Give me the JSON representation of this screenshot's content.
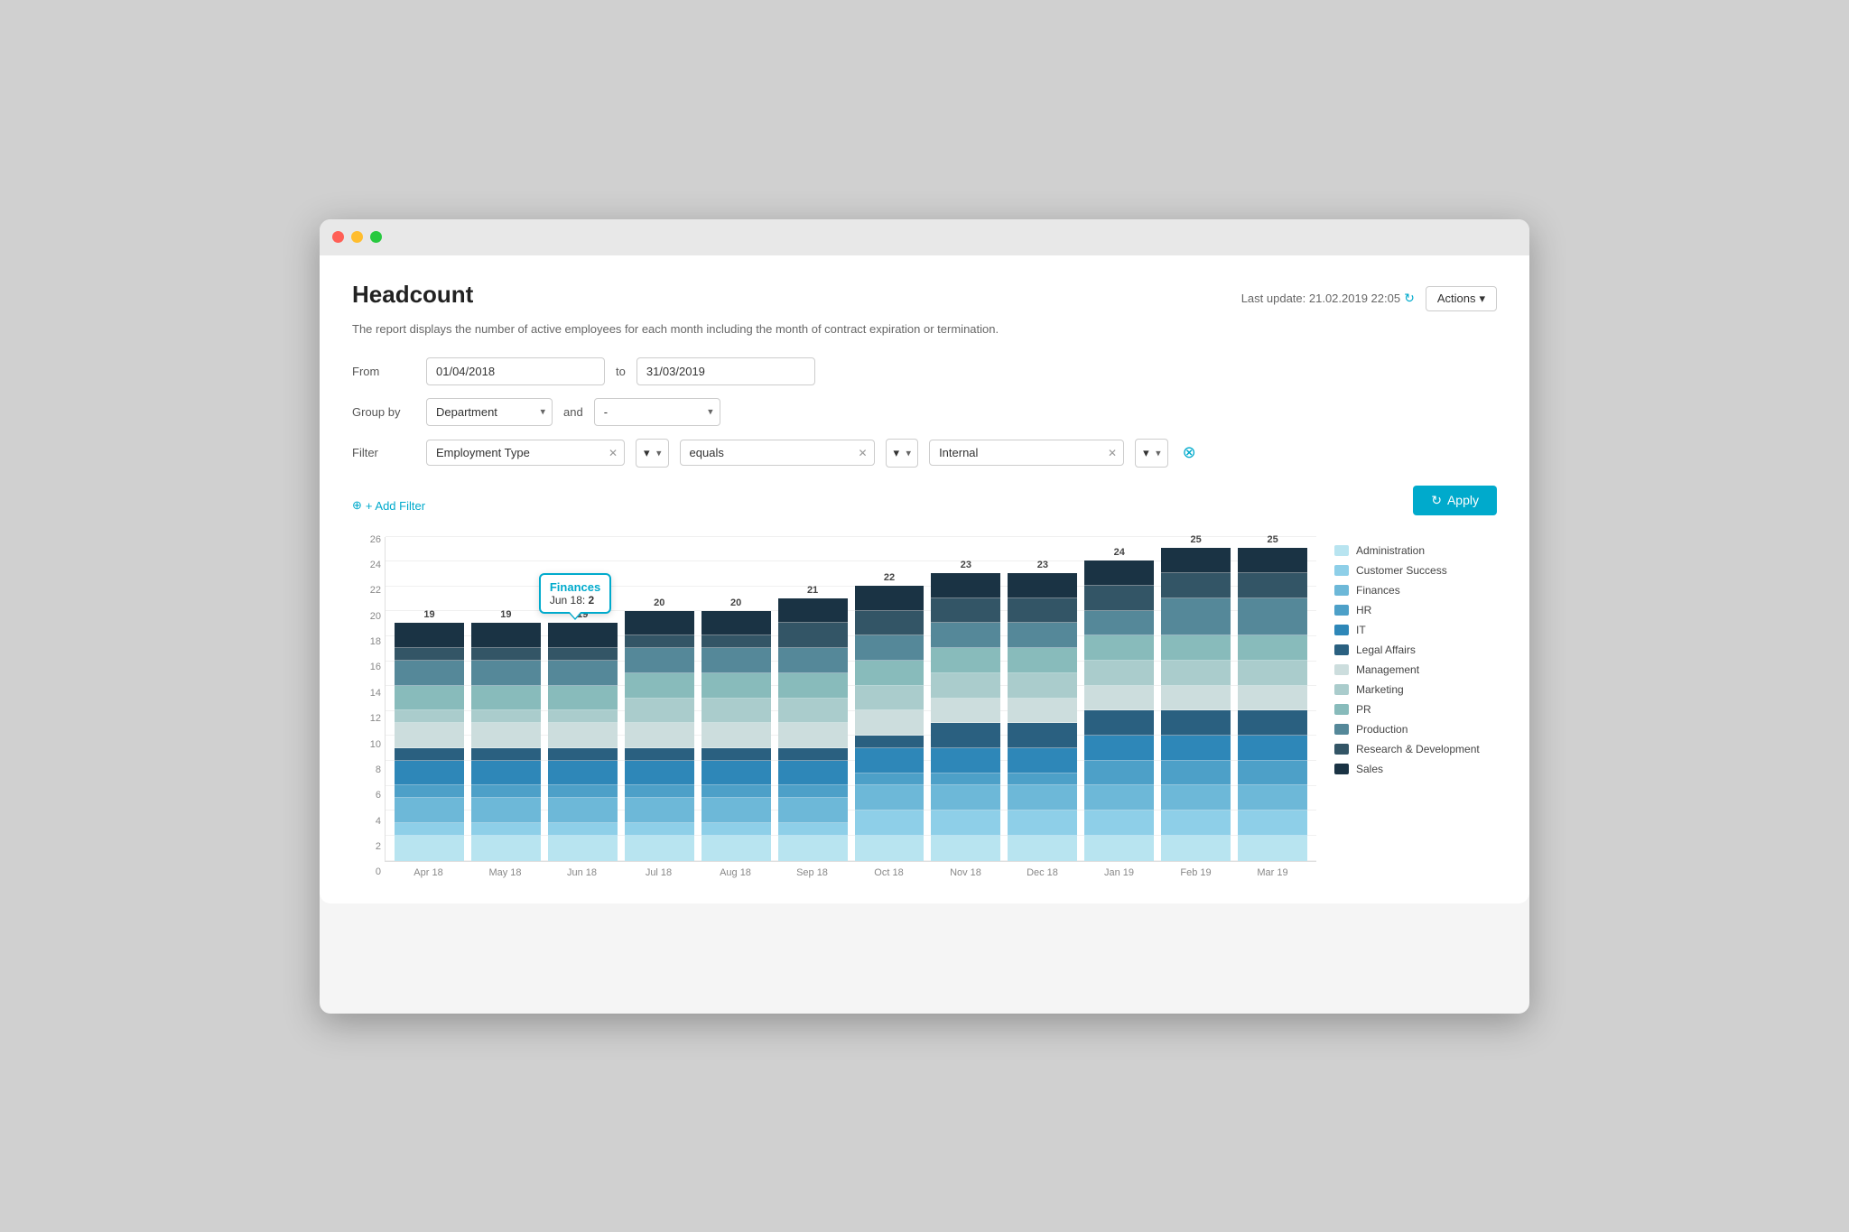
{
  "window": {
    "title": "Headcount"
  },
  "header": {
    "title": "Headcount",
    "last_update_label": "Last update: 21.02.2019 22:05",
    "actions_label": "Actions",
    "description": "The report displays the number of active employees for each month including the month of contract expiration or termination."
  },
  "form": {
    "from_label": "From",
    "from_value": "01/04/2018",
    "to_label": "to",
    "to_value": "31/03/2019",
    "group_by_label": "Group by",
    "group_by_value": "Department",
    "and_label": "and",
    "and_value": "-",
    "filter_label": "Filter",
    "filter_type": "Employment Type",
    "filter_equals": "equals",
    "filter_value": "Internal",
    "add_filter_label": "+ Add Filter",
    "apply_label": "Apply"
  },
  "chart": {
    "y_labels": [
      "0",
      "2",
      "4",
      "6",
      "8",
      "10",
      "12",
      "14",
      "16",
      "18",
      "20",
      "22",
      "24",
      "26"
    ],
    "x_labels": [
      "Apr 18",
      "May 18",
      "Jun 18",
      "Jul 18",
      "Aug 18",
      "Sep 18",
      "Oct 18",
      "Nov 18",
      "Dec 18",
      "Jan 19",
      "Feb 19",
      "Mar 19"
    ],
    "bar_totals": [
      "19",
      "19",
      "19",
      "20",
      "20",
      "21",
      "22",
      "23",
      "23",
      "24",
      "25",
      "25"
    ],
    "tooltip": {
      "title": "Finances",
      "line": "Jun 18: 2"
    },
    "segments": {
      "administration": {
        "color": "#b8e4f0",
        "label": "Administration"
      },
      "customer_success": {
        "color": "#8ecfe8",
        "label": "Customer Success"
      },
      "finances": {
        "color": "#6db8d8",
        "label": "Finances"
      },
      "hr": {
        "color": "#4da0c8",
        "label": "HR"
      },
      "it": {
        "color": "#2e87b8",
        "label": "IT"
      },
      "legal": {
        "color": "#2a6080",
        "label": "Legal Affairs"
      },
      "management": {
        "color": "#ccdddd",
        "label": "Management"
      },
      "marketing": {
        "color": "#aacccc",
        "label": "Marketing"
      },
      "pr": {
        "color": "#88bbbb",
        "label": "PR"
      },
      "production": {
        "color": "#558899",
        "label": "Production"
      },
      "rd": {
        "color": "#335566",
        "label": "Research & Development"
      },
      "sales": {
        "color": "#1a3344",
        "label": "Sales"
      }
    },
    "bars": [
      {
        "total": 19,
        "segments": [
          2,
          1,
          2,
          1,
          2,
          1,
          2,
          1,
          2,
          2,
          1,
          2
        ]
      },
      {
        "total": 19,
        "segments": [
          2,
          1,
          2,
          1,
          2,
          1,
          2,
          1,
          2,
          2,
          1,
          2
        ]
      },
      {
        "total": 19,
        "segments": [
          2,
          1,
          2,
          1,
          2,
          1,
          2,
          1,
          2,
          2,
          1,
          2
        ]
      },
      {
        "total": 20,
        "segments": [
          2,
          1,
          2,
          1,
          2,
          1,
          2,
          2,
          2,
          2,
          1,
          2
        ]
      },
      {
        "total": 20,
        "segments": [
          2,
          1,
          2,
          1,
          2,
          1,
          2,
          2,
          2,
          2,
          1,
          2
        ]
      },
      {
        "total": 21,
        "segments": [
          2,
          1,
          2,
          1,
          2,
          1,
          2,
          2,
          2,
          2,
          2,
          2
        ]
      },
      {
        "total": 22,
        "segments": [
          2,
          2,
          2,
          1,
          2,
          1,
          2,
          2,
          2,
          2,
          2,
          2
        ]
      },
      {
        "total": 23,
        "segments": [
          2,
          2,
          2,
          1,
          2,
          2,
          2,
          2,
          2,
          2,
          2,
          2
        ]
      },
      {
        "total": 23,
        "segments": [
          2,
          2,
          2,
          1,
          2,
          2,
          2,
          2,
          2,
          2,
          2,
          2
        ]
      },
      {
        "total": 24,
        "segments": [
          2,
          2,
          2,
          2,
          2,
          2,
          2,
          2,
          2,
          2,
          2,
          2
        ]
      },
      {
        "total": 25,
        "segments": [
          2,
          2,
          2,
          2,
          2,
          2,
          2,
          2,
          2,
          3,
          2,
          2
        ]
      },
      {
        "total": 25,
        "segments": [
          2,
          2,
          2,
          2,
          2,
          2,
          2,
          2,
          2,
          3,
          2,
          2
        ]
      }
    ]
  },
  "legend": [
    {
      "label": "Administration",
      "color": "#b8e4f0"
    },
    {
      "label": "Customer Success",
      "color": "#8ecfe8"
    },
    {
      "label": "Finances",
      "color": "#6db8d8"
    },
    {
      "label": "HR",
      "color": "#4da0c8"
    },
    {
      "label": "IT",
      "color": "#2e87b8"
    },
    {
      "label": "Legal Affairs",
      "color": "#2a6080"
    },
    {
      "label": "Management",
      "color": "#ccdddd"
    },
    {
      "label": "Marketing",
      "color": "#aacccc"
    },
    {
      "label": "PR",
      "color": "#88bbbb"
    },
    {
      "label": "Production",
      "color": "#558899"
    },
    {
      "label": "Research & Development",
      "color": "#335566"
    },
    {
      "label": "Sales",
      "color": "#1a3344"
    }
  ]
}
